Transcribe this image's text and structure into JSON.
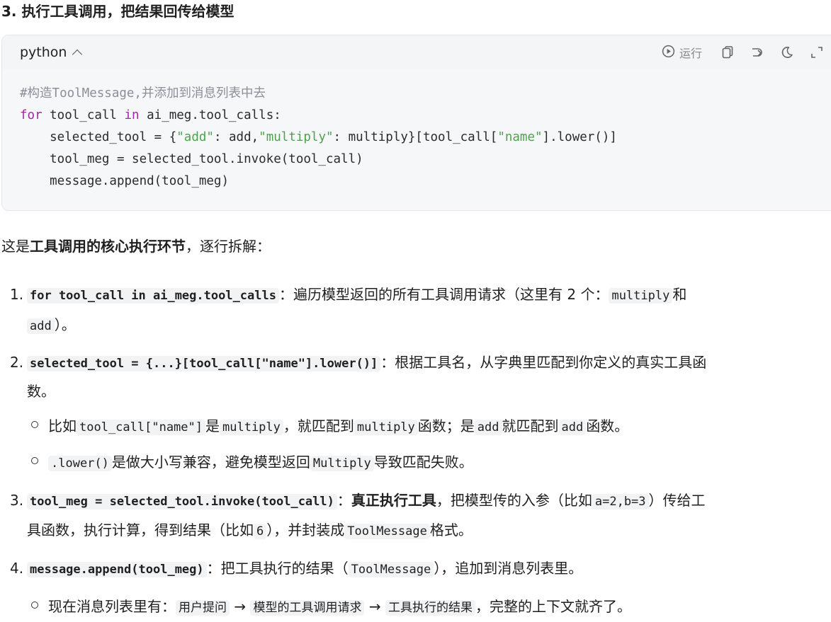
{
  "section_title": "3. 执行工具调用，把结果回传给模型",
  "code_block": {
    "language": "python",
    "run_label": "运行",
    "lines": {
      "comment": "#构造ToolMessage,并添加到消息列表中去",
      "l2_kw_for": "for",
      "l2_a": " tool_call ",
      "l2_kw_in": "in",
      "l2_b": " ai_meg.tool_calls:",
      "l3_a": "    selected_tool = {",
      "l3_s1": "\"add\"",
      "l3_b": ": add,",
      "l3_s2": "\"multiply\"",
      "l3_c": ": multiply}[tool_call[",
      "l3_s3": "\"name\"",
      "l3_d": "].lower()]",
      "l4": "    tool_meg = selected_tool.invoke(tool_call)",
      "l5": "    message.append(tool_meg)"
    }
  },
  "intro": {
    "pre": "这是",
    "bold": "工具调用的核心执行环节",
    "post": "，逐行拆解："
  },
  "items": {
    "i1": {
      "num": "1.",
      "code": "for tool_call in ai_meg.tool_calls",
      "text": "：遍历模型返回的所有工具调用请求（这里有 2 个：",
      "code2": "multiply",
      "text2": "和",
      "code3": "add",
      "text3": "）。"
    },
    "i2": {
      "num": "2.",
      "code": "selected_tool = {...}[tool_call[\"name\"].lower()]",
      "text": "：根据工具名，从字典里匹配到你定义的真实工具函",
      "text_cont": "数。",
      "sub1": {
        "t1": "比如",
        "c1": "tool_call[\"name\"]",
        "t2": "是",
        "c2": "multiply",
        "t3": "，就匹配到",
        "c3": "multiply",
        "t4": "函数；是",
        "c4": "add",
        "t5": "就匹配到",
        "c5": "add",
        "t6": "函数。"
      },
      "sub2": {
        "c1": ".lower()",
        "t1": "是做大小写兼容，避免模型返回",
        "c2": "Multiply",
        "t2": "导致匹配失败。"
      }
    },
    "i3": {
      "num": "3.",
      "code": "tool_meg = selected_tool.invoke(tool_call)",
      "t1": "：",
      "bold": "真正执行工具",
      "t2": "，把模型传的入参（比如",
      "c1": "a=2,b=3",
      "t3": "）传给工",
      "cont1": "具函数，执行计算，得到结果（比如",
      "c2": "6",
      "cont2": "），并封装成",
      "c3": "ToolMessage",
      "cont3": "格式。"
    },
    "i4": {
      "num": "4.",
      "code": "message.append(tool_meg)",
      "t1": "：把工具执行的结果（",
      "c1": "ToolMessage",
      "t2": "），追加到消息列表里。",
      "sub1": {
        "t1": "现在消息列表里有：",
        "c1": "用户提问",
        "arrow1": "→",
        "c2": "模型的工具调用请求",
        "arrow2": "→",
        "c3": "工具执行的结果",
        "t2": "，完整的上下文就齐了。"
      }
    }
  }
}
